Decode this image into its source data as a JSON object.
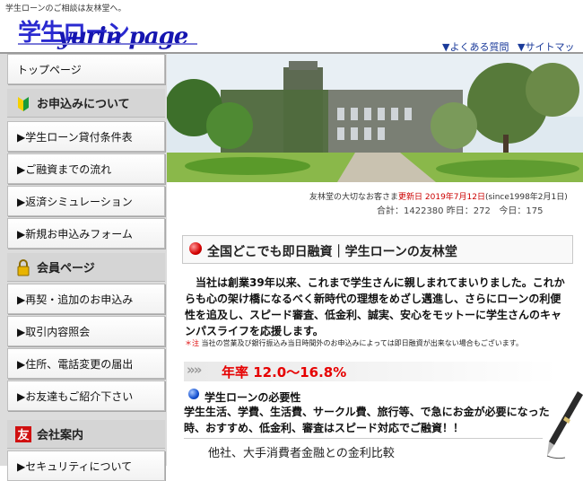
{
  "header": {
    "tagline": "学生ローンのご相談は友林堂へ。",
    "logo_kana": "学生ローン",
    "logo_script": "yurin page",
    "links": {
      "faq": "▼よくある質問",
      "sitemap": "▼サイトマップ"
    }
  },
  "sidebar": {
    "top": "トップページ",
    "apply_head": "お申込みについて",
    "apply_items": [
      "▶学生ローン貸付条件表",
      "▶ご融資までの流れ",
      "▶返済シミュレーション",
      "▶新規お申込みフォーム"
    ],
    "member_head": "会員ページ",
    "member_items": [
      "▶再契・追加のお申込み",
      "▶取引内容照会",
      "▶住所、電話変更の届出",
      "▶お友達もご紹介下さい"
    ],
    "company_head": "会社案内",
    "company_items": [
      "▶セキュリティについて"
    ]
  },
  "update": {
    "prefix": "友林堂の大切なお客さま",
    "label": "更新日",
    "date": "2019年7月12日",
    "since": "(since1998年2月1日)"
  },
  "counter": {
    "total_label": "合計：",
    "total": "1422380",
    "yesterday_label": "昨日：",
    "yesterday": "272",
    "today_label": "今日：",
    "today": "175"
  },
  "main": {
    "title": "全国どこでも即日融資｜学生ローンの友林堂",
    "intro": "　当社は創業39年以来、これまで学生さんに親しまれてまいりました。これからも心の架け橋になるべく新時代の理想をめざし邁進し、さらにローンの利便性を追及し、スピード審査、低金利、誠実、安心をモットーに学生さんのキャンパスライフを応援します。",
    "note_mark": "＊注",
    "note": "当社の営業及び銀行振込み当日時間外のお申込みによっては即日融資が出来ない場合もございます。",
    "rate": "年率 12.0～16.8%",
    "need_title": "学生ローンの必要性",
    "need_body": "学生生活、学費、生活費、サークル費、旅行等、で急にお金が必要になった時、おすすめ、低金利、審査はスピード対応でご融資！！",
    "compare": "他社、大手消費者金融との金利比較"
  },
  "colors": {
    "accent_red": "#e60000",
    "link_blue": "#1a3a9a",
    "logo_blue": "#2a2ad0"
  }
}
